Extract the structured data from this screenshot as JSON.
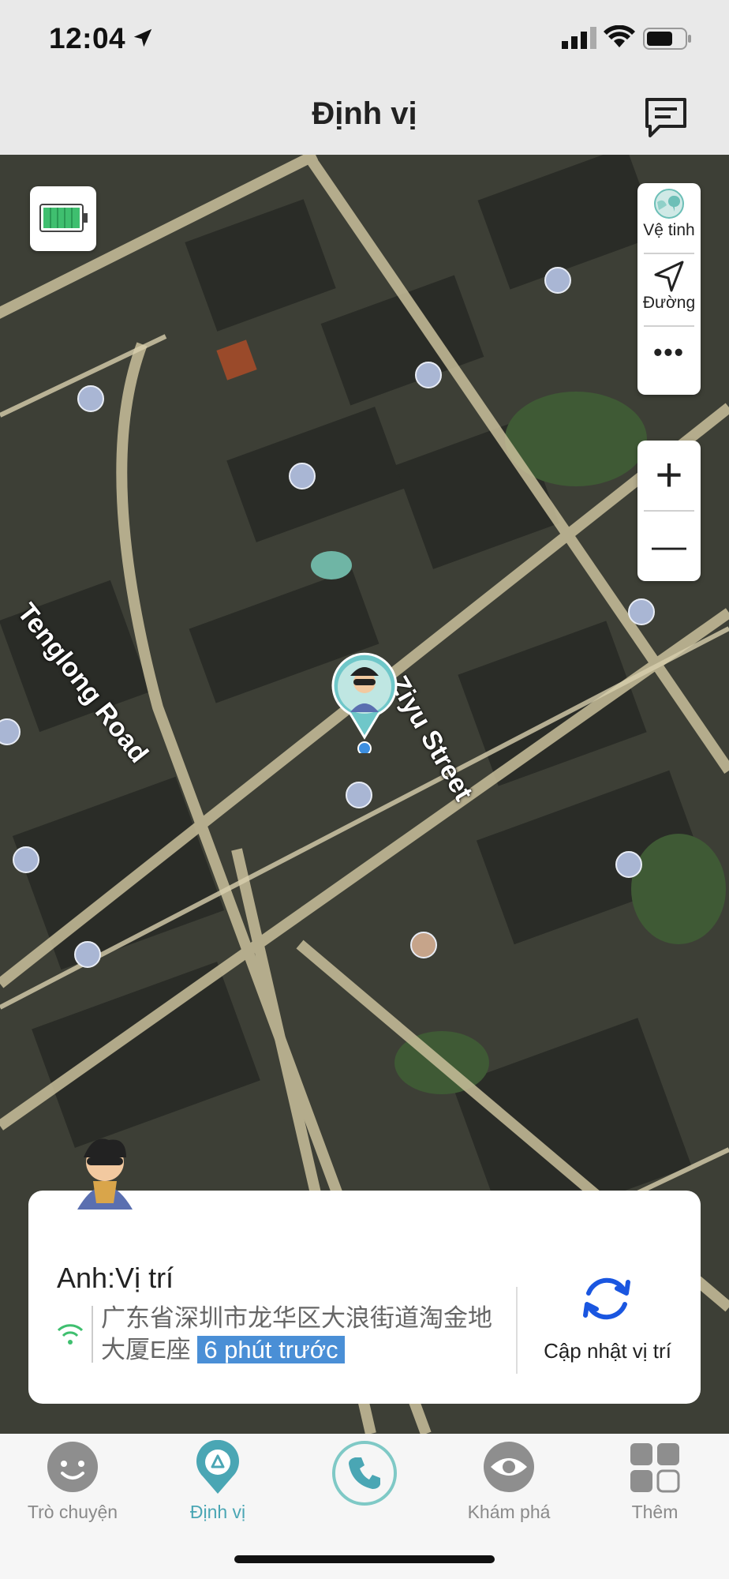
{
  "status_bar": {
    "time": "12:04"
  },
  "header": {
    "title": "Định vị",
    "message_icon": "message-icon"
  },
  "map": {
    "labels": {
      "road1": "Tenglong Road",
      "road2": "Ziyu Street"
    },
    "controls": {
      "satellite_label": "Vệ tinh",
      "route_label": "Đường",
      "more_label": "•••",
      "zoom_in": "+",
      "zoom_out": "—"
    }
  },
  "location_card": {
    "name": "Anh:Vị trí",
    "address": "广东省深圳市龙华区大浪街道淘金地大厦E座",
    "time_ago": "6 phút trước",
    "refresh_label": "Cập nhật vị trí"
  },
  "tabbar": {
    "tabs": [
      {
        "label": "Trò chuyện",
        "icon": "chat-smile-icon"
      },
      {
        "label": "Định vị",
        "icon": "location-pin-icon",
        "active": true
      },
      {
        "label": "",
        "icon": "phone-icon"
      },
      {
        "label": "Khám phá",
        "icon": "eye-icon"
      },
      {
        "label": "Thêm",
        "icon": "grid-icon"
      }
    ]
  },
  "colors": {
    "accent": "#4aa6b4",
    "time_badge": "#4a8fd6",
    "refresh_blue": "#1a56e0"
  }
}
